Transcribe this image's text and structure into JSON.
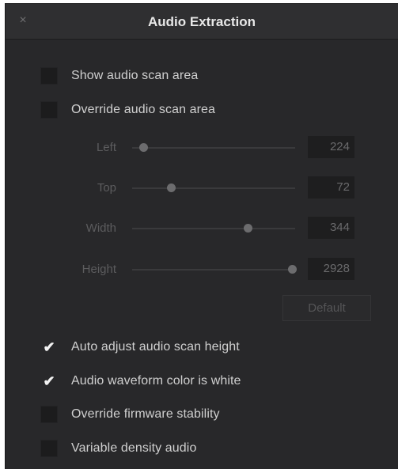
{
  "dialog": {
    "title": "Audio Extraction",
    "close_glyph": "×"
  },
  "options_top": [
    {
      "label": "Show audio scan area",
      "checked": false
    },
    {
      "label": "Override audio scan area",
      "checked": false
    }
  ],
  "sliders": [
    {
      "label": "Left",
      "value": "224",
      "fraction": 0.07
    },
    {
      "label": "Top",
      "value": "72",
      "fraction": 0.24
    },
    {
      "label": "Width",
      "value": "344",
      "fraction": 0.71
    },
    {
      "label": "Height",
      "value": "2928",
      "fraction": 0.98
    }
  ],
  "default_button": "Default",
  "options_bottom": [
    {
      "label": "Auto adjust audio scan height",
      "checked": true
    },
    {
      "label": "Audio waveform color is white",
      "checked": true
    },
    {
      "label": "Override firmware stability",
      "checked": false
    },
    {
      "label": "Variable density audio",
      "checked": false
    }
  ],
  "check_glyph": "✔"
}
